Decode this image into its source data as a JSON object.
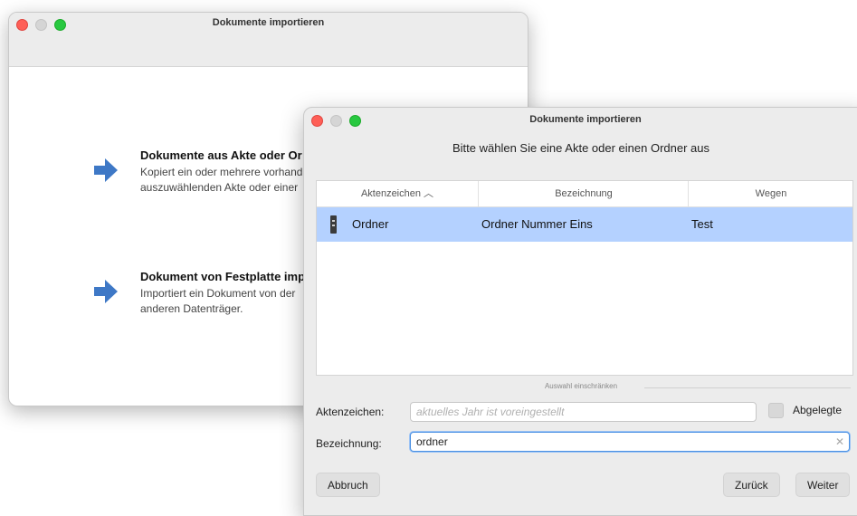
{
  "back_window": {
    "title": "Dokumente importieren",
    "options": [
      {
        "title": "Dokumente aus Akte oder Or",
        "desc_line1": "Kopiert ein oder mehrere vorhand",
        "desc_line2": "auszuwählenden Akte oder einer"
      },
      {
        "title": "Dokument von Festplatte imp",
        "desc_line1": "Importiert ein Dokument von der",
        "desc_line2": "anderen Datenträger."
      }
    ],
    "arrow_color": "#3e78c6"
  },
  "dialog": {
    "title": "Dokumente importieren",
    "subtitle": "Bitte wählen Sie eine Akte oder einen Ordner aus",
    "table": {
      "columns": [
        "Aktenzeichen ︿",
        "Bezeichnung",
        "Wegen"
      ],
      "rows": [
        {
          "icon": "binder-icon",
          "aktenzeichen": "Ordner",
          "bezeichnung": "Ordner Nummer Eins",
          "wegen": "Test",
          "selected": true
        }
      ]
    },
    "filter_section_label": "Auswahl einschränken",
    "aktenzeichen_label": "Aktenzeichen:",
    "aktenzeichen_placeholder": "aktuelles Jahr ist voreingestellt",
    "abgelegte_label": "Abgelegte",
    "bezeichnung_label": "Bezeichnung:",
    "bezeichnung_value": "ordner",
    "clear_glyph": "✕",
    "buttons": {
      "cancel": "Abbruch",
      "back": "Zurück",
      "next": "Weiter"
    },
    "selection_color": "#b4d1ff",
    "focus_color": "#4a90e2"
  }
}
